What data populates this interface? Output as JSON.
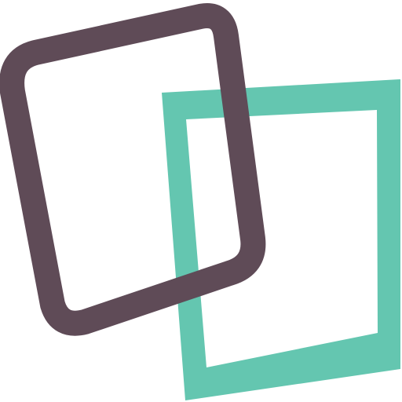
{
  "logo": {
    "name": "overlapping-frames-logo",
    "colors": {
      "background": "#ffffff",
      "rounded_frame": "#5f4b57",
      "square_frame": "#64c6b0"
    }
  }
}
